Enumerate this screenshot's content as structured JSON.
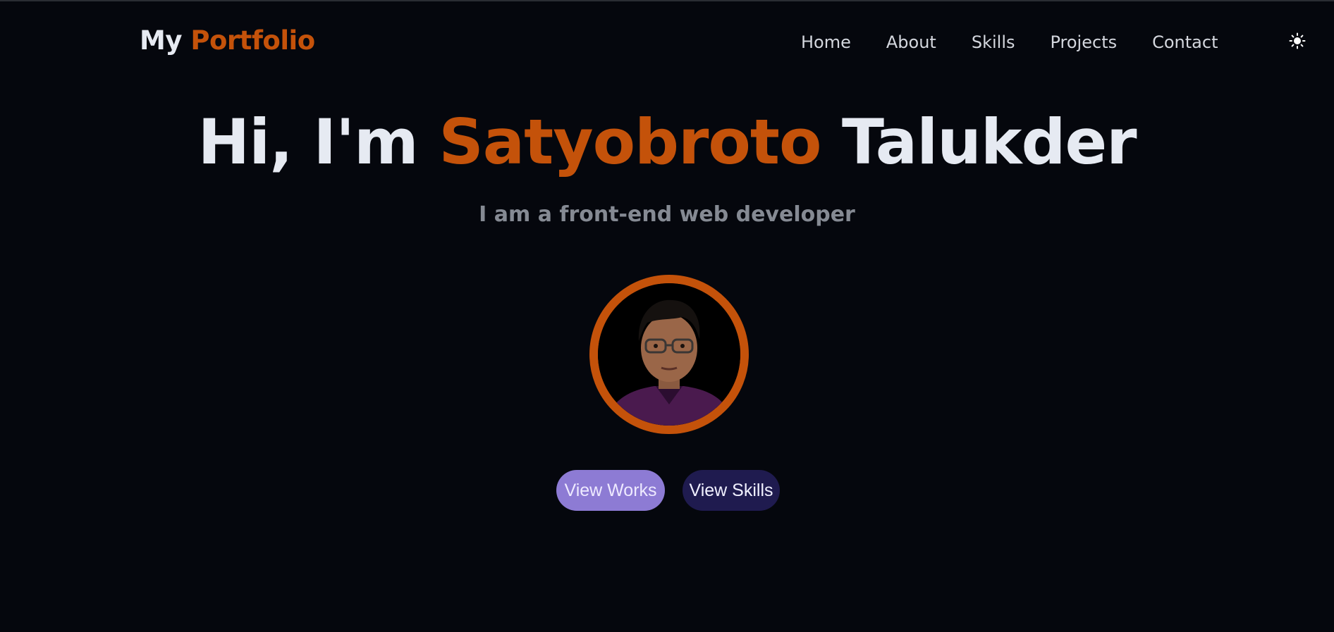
{
  "header": {
    "logo_part1": "My",
    "logo_part2": "Portfolio",
    "nav": [
      {
        "label": "Home"
      },
      {
        "label": "About"
      },
      {
        "label": "Skills"
      },
      {
        "label": "Projects"
      },
      {
        "label": "Contact"
      }
    ],
    "theme_toggle_icon": "sun-icon"
  },
  "hero": {
    "greeting": "Hi, I'm",
    "first_name": "Satyobroto",
    "last_name": "Talukder",
    "subtitle": "I am a front-end web developer",
    "avatar_icon": "profile-photo",
    "buttons": {
      "works": "View Works",
      "skills": "View Skills"
    }
  },
  "colors": {
    "background": "#05070d",
    "accent": "#c4520a",
    "primary_button": "#8d7bd4",
    "secondary_button": "#1f1b4f",
    "text": "#e6eaf2",
    "muted_text": "#858a93"
  }
}
